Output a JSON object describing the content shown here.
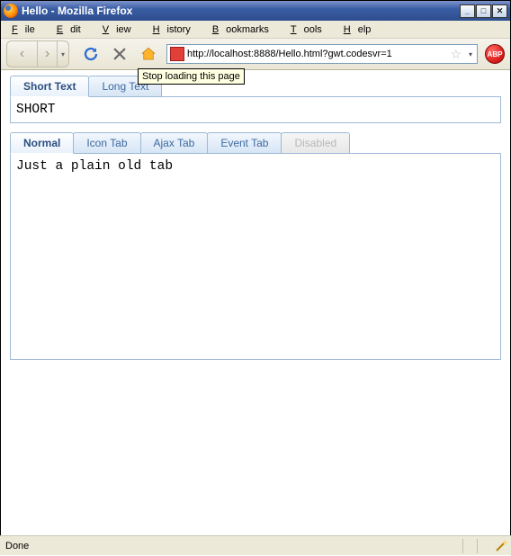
{
  "window": {
    "title": "Hello - Mozilla Firefox",
    "controls": {
      "min": "_",
      "max": "□",
      "close": "✕"
    }
  },
  "menu": {
    "file": "File",
    "edit": "Edit",
    "view": "View",
    "history": "History",
    "bookmarks": "Bookmarks",
    "tools": "Tools",
    "help": "Help"
  },
  "toolbar": {
    "back_icon": "‹",
    "fwd_icon": "›",
    "dropdown_icon": "▾",
    "reload": "reload-icon",
    "stop": "stop-icon",
    "home": "home-icon",
    "url": "http://localhost:8888/Hello.html?gwt.codesvr=1",
    "star": "☆",
    "abp_label": "ABP",
    "tooltip": "Stop loading this page"
  },
  "tabset1": {
    "tabs": [
      {
        "label": "Short Text",
        "active": true
      },
      {
        "label": "Long Text",
        "active": false
      }
    ],
    "content": "SHORT"
  },
  "tabset2": {
    "tabs": [
      {
        "label": "Normal",
        "active": true,
        "disabled": false
      },
      {
        "label": "Icon Tab",
        "active": false,
        "disabled": false
      },
      {
        "label": "Ajax Tab",
        "active": false,
        "disabled": false
      },
      {
        "label": "Event Tab",
        "active": false,
        "disabled": false
      },
      {
        "label": "Disabled",
        "active": false,
        "disabled": true
      }
    ],
    "content": "Just a plain old tab"
  },
  "status": {
    "text": "Done"
  }
}
